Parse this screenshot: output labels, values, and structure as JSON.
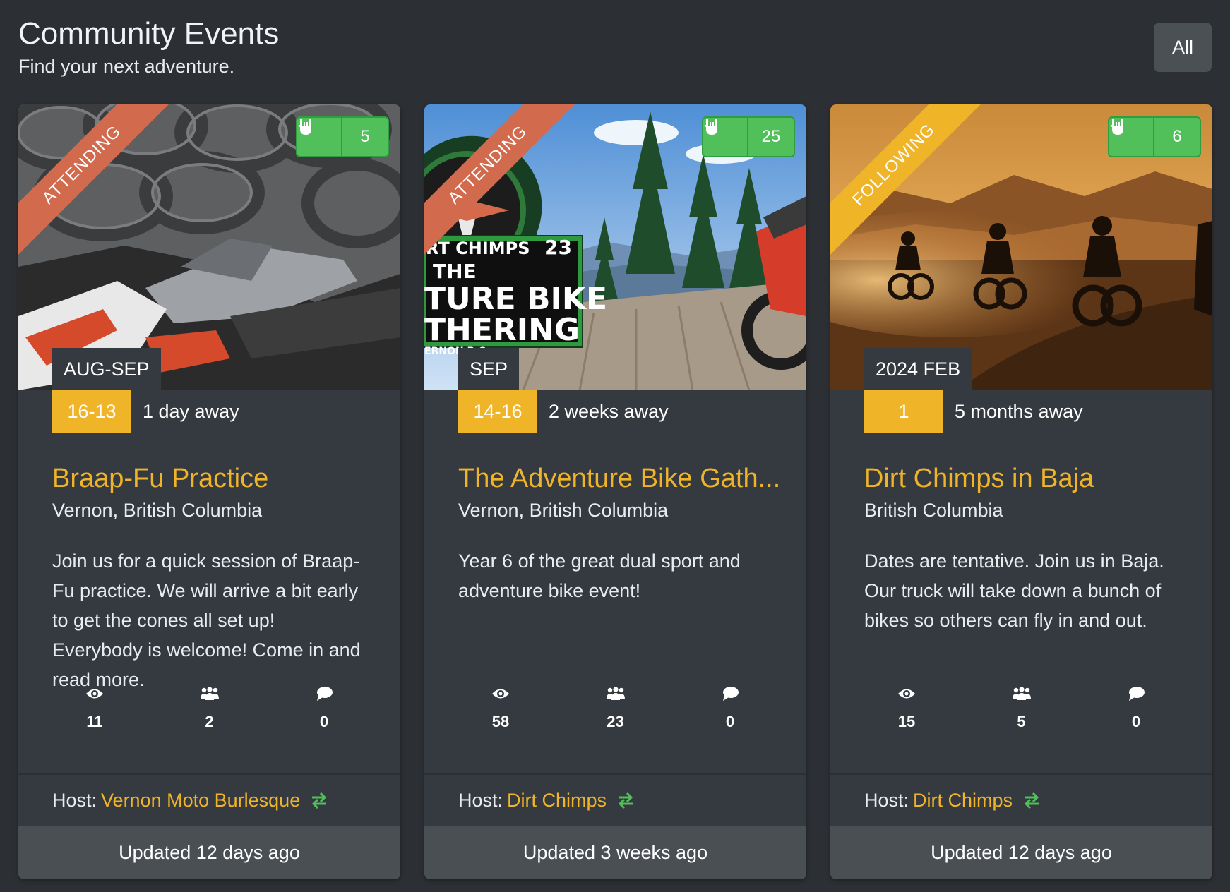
{
  "header": {
    "title": "Community Events",
    "subtitle": "Find your next adventure.",
    "filter_label": "All"
  },
  "colors": {
    "accent": "#f0b429",
    "attending_ribbon": "#d26a4e",
    "following_ribbon": "#f0b429",
    "like_green": "#52c05a",
    "card_bg": "#353a40"
  },
  "events": [
    {
      "status": "ATTENDING",
      "likes": "5",
      "month": "AUG-SEP",
      "days": "16-13",
      "countdown": "1 day away",
      "title": "Braap-Fu Practice",
      "location": "Vernon, British Columbia",
      "description": "Join us for a quick session of Braap-Fu practice. We will arrive a bit early to get the cones all set up! Everybody is welcome! Come in and read more.",
      "views": "11",
      "attendees": "2",
      "comments": "0",
      "host_label": "Host:",
      "host": "Vernon Moto Burlesque",
      "updated": "Updated 12 days ago"
    },
    {
      "status": "ATTENDING",
      "likes": "25",
      "month": "SEP",
      "days": "14-16",
      "countdown": "2 weeks away",
      "title": "The Adventure Bike Gath...",
      "location": "Vernon, British Columbia",
      "description": "Year 6 of the great dual sport and adventure bike event!",
      "views": "58",
      "attendees": "23",
      "comments": "0",
      "host_label": "Host:",
      "host": "Dirt Chimps",
      "updated": "Updated 3 weeks ago",
      "image_text": [
        "RT CHIMPS",
        "23",
        "THE",
        "TURE BIKE",
        "THERING",
        "ERNON B.C."
      ]
    },
    {
      "status": "FOLLOWING",
      "likes": "6",
      "month": "2024 FEB",
      "days": "1",
      "countdown": "5 months away",
      "title": "Dirt Chimps in Baja",
      "location": "British Columbia",
      "description": "Dates are tentative. Join us in Baja. Our truck will take down a bunch of bikes so others can fly in and out.",
      "views": "15",
      "attendees": "5",
      "comments": "0",
      "host_label": "Host:",
      "host": "Dirt Chimps",
      "updated": "Updated 12 days ago"
    }
  ],
  "icons": {
    "like": "rock-hand-icon",
    "views": "eye-icon",
    "attendees": "users-icon",
    "comments": "comment-icon",
    "switch": "exchange-icon"
  }
}
